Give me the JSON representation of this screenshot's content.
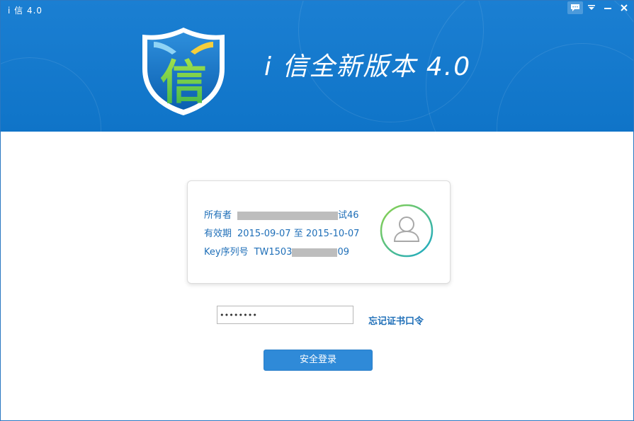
{
  "window": {
    "title": "i 信 4.0"
  },
  "header": {
    "headline": "i 信全新版本 4.0",
    "logo_char": "信"
  },
  "card": {
    "owner_label": "所有者",
    "owner_value_visible": "试46",
    "validity_label": "有效期",
    "validity_value": "2015-09-07 至 2015-10-07",
    "serial_label": "Key序列号",
    "serial_prefix": "TW1503",
    "serial_suffix": "09"
  },
  "form": {
    "password_value": "••••••••",
    "forgot_label": "忘记证书口令",
    "login_label": "安全登录"
  },
  "colors": {
    "header_blue": "#1078cc",
    "link_blue": "#1f6fb8",
    "button_blue": "#2f8ad8",
    "avatar_ring_start": "#8ed34a",
    "avatar_ring_end": "#19a9c9"
  },
  "icons": {
    "feedback": "message-icon",
    "menu": "dropdown-menu-icon",
    "minimize": "minimize-icon",
    "close": "close-icon",
    "avatar": "user-avatar-icon"
  }
}
